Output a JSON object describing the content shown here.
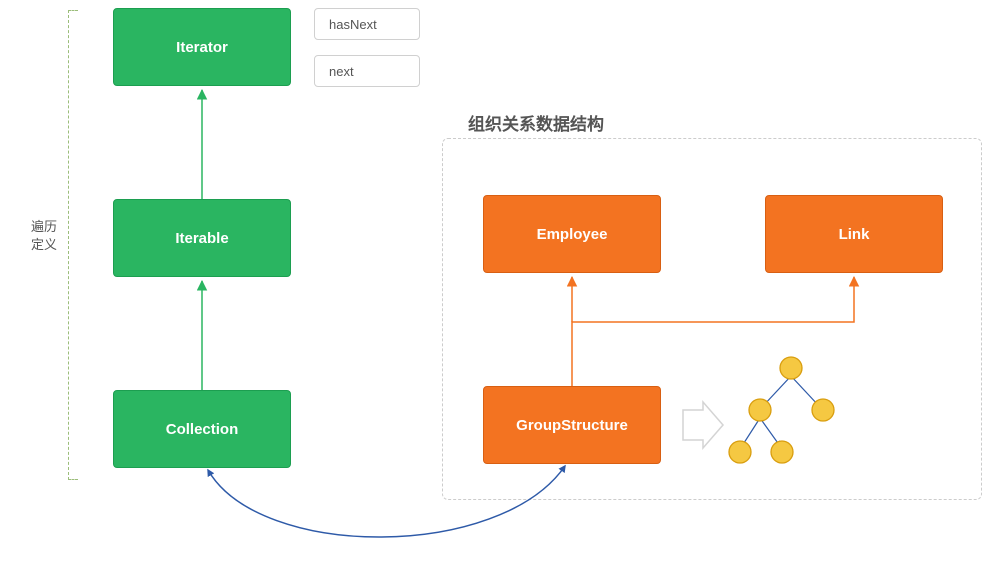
{
  "left": {
    "bracket_label_line1": "遍历",
    "bracket_label_line2": "定义",
    "boxes": {
      "iterator": "Iterator",
      "iterable": "Iterable",
      "collection": "Collection"
    },
    "methods": {
      "hasNext": "hasNext",
      "next": "next"
    }
  },
  "right": {
    "section_title": "组织关系数据结构",
    "boxes": {
      "employee": "Employee",
      "link": "Link",
      "group_structure": "GroupStructure"
    }
  },
  "colors": {
    "green": "#2ab561",
    "orange": "#f37321",
    "yellow_node": "#f5c842",
    "yellow_node_border": "#d99e0f",
    "blue_arrow": "#2e5aa8"
  }
}
